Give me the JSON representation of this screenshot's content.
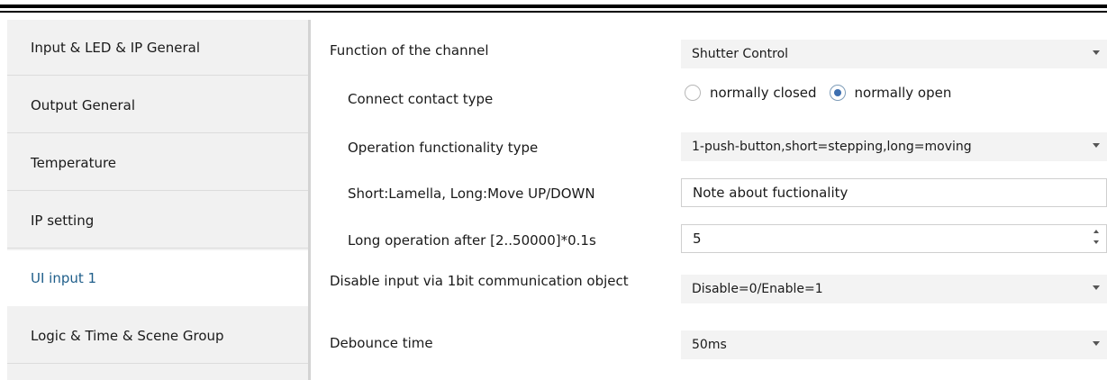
{
  "sidebar": {
    "items": [
      {
        "label": "Input & LED & IP General"
      },
      {
        "label": "Output General"
      },
      {
        "label": "Temperature"
      },
      {
        "label": "IP setting"
      },
      {
        "label": "UI input 1",
        "active": true
      },
      {
        "label": "Logic & Time & Scene Group"
      }
    ]
  },
  "params": {
    "function": {
      "label": "Function of the channel",
      "value": "Shutter Control"
    },
    "contact": {
      "label": "Connect contact type",
      "options": [
        "normally closed",
        "normally open"
      ],
      "selected": "normally open"
    },
    "operation": {
      "label": "Operation functionality type",
      "value": "1-push-button,short=stepping,long=moving"
    },
    "note": {
      "label": "Short:Lamella, Long:Move UP/DOWN",
      "value": "Note about fuctionality"
    },
    "long_op": {
      "label": "Long operation after [2..50000]*0.1s",
      "value": "5"
    },
    "disable": {
      "label": "Disable input via 1bit communication object",
      "value": "Disable=0/Enable=1"
    },
    "debounce": {
      "label": "Debounce time",
      "value": "50ms"
    }
  },
  "colors": {
    "active_text": "#1f5e8a",
    "sidebar_bg": "#f1f1f1",
    "select_bg": "#f3f3f3"
  }
}
